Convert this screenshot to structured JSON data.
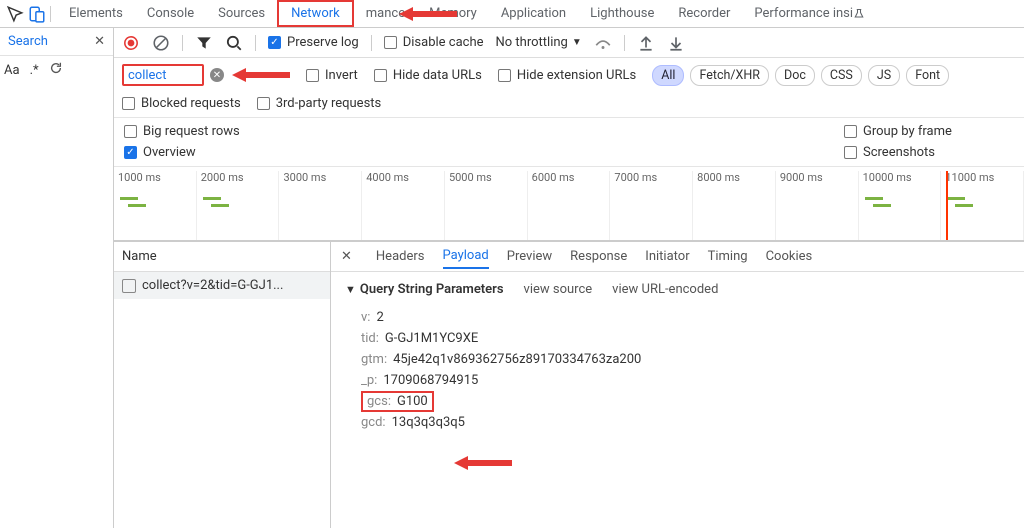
{
  "topTabs": [
    "Elements",
    "Console",
    "Sources",
    "Network",
    "mance",
    "Memory",
    "Application",
    "Lighthouse",
    "Recorder",
    "Performance insi"
  ],
  "activeTopTab": 3,
  "sidebar": {
    "title": "Search",
    "row": [
      "Aa",
      ".*"
    ]
  },
  "toolbar": {
    "preserve": "Preserve log",
    "disable": "Disable cache",
    "throttle": "No throttling"
  },
  "filter": {
    "value": "collect",
    "invert": "Invert",
    "hideData": "Hide data URLs",
    "hideExt": "Hide extension URLs",
    "pills": [
      "All",
      "Fetch/XHR",
      "Doc",
      "CSS",
      "JS",
      "Font"
    ],
    "blocked": "Blocked requests",
    "third": "3rd-party requests"
  },
  "view": {
    "big": "Big request rows",
    "overview": "Overview",
    "group": "Group by frame",
    "shots": "Screenshots"
  },
  "timeline": [
    "1000 ms",
    "2000 ms",
    "3000 ms",
    "4000 ms",
    "5000 ms",
    "6000 ms",
    "7000 ms",
    "8000 ms",
    "9000 ms",
    "10000 ms",
    "11000 ms"
  ],
  "nameHeader": "Name",
  "request": "collect?v=2&tid=G-GJ1...",
  "detailTabs": [
    "Headers",
    "Payload",
    "Preview",
    "Response",
    "Initiator",
    "Timing",
    "Cookies"
  ],
  "activeDetailTab": 1,
  "section": {
    "title": "Query String Parameters",
    "viewSrc": "view source",
    "viewUrl": "view URL-encoded"
  },
  "params": [
    {
      "k": "v:",
      "v": "2"
    },
    {
      "k": "tid:",
      "v": "G-GJ1M1YC9XE"
    },
    {
      "k": "gtm:",
      "v": "45je42q1v869362756z89170334763za200"
    },
    {
      "k": "_p:",
      "v": "1709068794915"
    },
    {
      "k": "gcs:",
      "v": "G100"
    },
    {
      "k": "gcd:",
      "v": "13q3q3q3q5"
    }
  ],
  "highlightParam": 4
}
